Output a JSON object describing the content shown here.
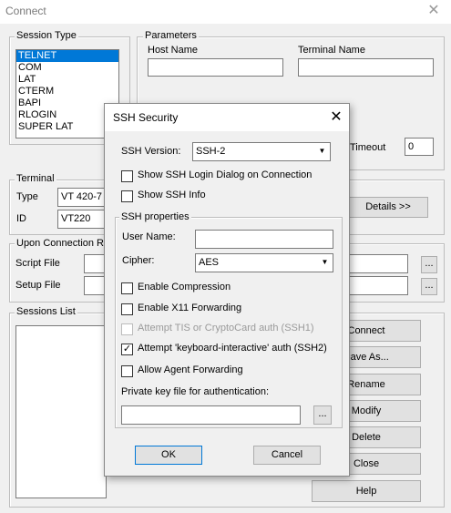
{
  "window": {
    "title": "Connect",
    "close_glyph": "✕"
  },
  "session_type": {
    "label": "Session Type",
    "items": [
      "TELNET",
      "COM",
      "LAT",
      "CTERM",
      "BAPI",
      "RLOGIN",
      "SUPER LAT"
    ],
    "selected": "TELNET"
  },
  "parameters": {
    "label": "Parameters",
    "host_name_label": "Host Name",
    "host_name_value": "",
    "terminal_name_label": "Terminal Name",
    "terminal_name_value": "",
    "timeout_label": "Timeout",
    "timeout_value": "0"
  },
  "terminal": {
    "label": "Terminal",
    "type_label": "Type",
    "type_value": "VT 420-7",
    "id_label": "ID",
    "id_value": "VT220",
    "details_button": "Details >>"
  },
  "upon_connection": {
    "label": "Upon Connection Ru",
    "script_file_label": "Script File",
    "setup_file_label": "Setup File",
    "browse_glyph": "..."
  },
  "sessions_list": {
    "label": "Sessions List"
  },
  "side_buttons": {
    "connect": "Connect",
    "save_as": "Save As...",
    "rename": "Rename",
    "modify": "Modify",
    "delete": "Delete",
    "close": "Close",
    "help": "Help"
  },
  "ssh_dialog": {
    "title": "SSH Security",
    "close_glyph": "✕",
    "ssh_version_label": "SSH Version:",
    "ssh_version_value": "SSH-2",
    "show_login_dialog": {
      "label": "Show SSH Login Dialog on Connection",
      "checked": false
    },
    "show_ssh_info": {
      "label": "Show SSH Info",
      "checked": false
    },
    "properties_label": "SSH properties",
    "user_name_label": "User Name:",
    "user_name_value": "",
    "cipher_label": "Cipher:",
    "cipher_value": "AES",
    "enable_compression": {
      "label": "Enable Compression",
      "checked": false
    },
    "enable_x11": {
      "label": "Enable X11 Forwarding",
      "checked": false
    },
    "tis_auth": {
      "label": "Attempt TIS or CryptoCard auth (SSH1)",
      "checked": false,
      "disabled": true
    },
    "keyboard_interactive": {
      "label": "Attempt 'keyboard-interactive' auth (SSH2)",
      "checked": true
    },
    "agent_forwarding": {
      "label": "Allow Agent Forwarding",
      "checked": false
    },
    "private_key_label": "Private key file for authentication:",
    "private_key_value": "",
    "browse_glyph": "...",
    "ok_button": "OK",
    "cancel_button": "Cancel",
    "check_glyph": "✓",
    "dropdown_glyph": "▼"
  }
}
